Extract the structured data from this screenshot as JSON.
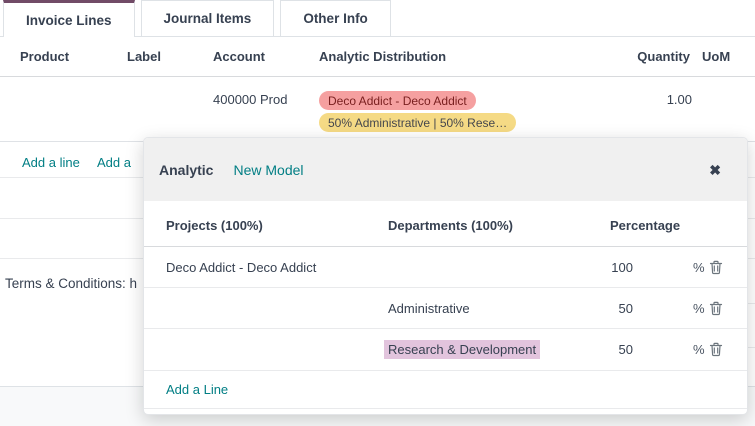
{
  "tabs": [
    {
      "label": "Invoice Lines",
      "active": true
    },
    {
      "label": "Journal Items",
      "active": false
    },
    {
      "label": "Other Info",
      "active": false
    }
  ],
  "invoice_table": {
    "headers": [
      "Product",
      "Label",
      "Account",
      "Analytic Distribution",
      "Quantity",
      "UoM"
    ],
    "row": {
      "account": "400000 Prod",
      "quantity": "1.00",
      "tags": [
        {
          "label": "Deco Addict - Deco Addict"
        },
        {
          "label": "50% Administrative | 50% Rese…"
        }
      ]
    },
    "add_line": "Add a line",
    "add_partial": "Add a"
  },
  "terms_text": "Terms & Conditions: h",
  "popup": {
    "title": "Analytic",
    "new_model": "New Model",
    "close": "✖",
    "columns": [
      "Projects (100%)",
      "Departments (100%)",
      "Percentage"
    ],
    "rows": [
      {
        "project": "Deco Addict - Deco Addict",
        "department": "",
        "value": "100",
        "unit": "%"
      },
      {
        "project": "",
        "department": "Administrative",
        "value": "50",
        "unit": "%"
      },
      {
        "project": "",
        "department": "Research & Development",
        "value": "50",
        "unit": "%"
      }
    ],
    "add_line": "Add a Line"
  },
  "colors": {
    "accent_teal": "#017e84",
    "tab_accent": "#714b67",
    "tag_pink_bg": "#f5a0a0",
    "tag_pink_text": "#7a2020",
    "tag_yellow_bg": "#f5da85",
    "tag_yellow_text": "#45474d",
    "selection_highlight": "#e2c4dd",
    "popup_header_bg": "#f0f0f0",
    "footer_bg": "#f8f9fa"
  }
}
